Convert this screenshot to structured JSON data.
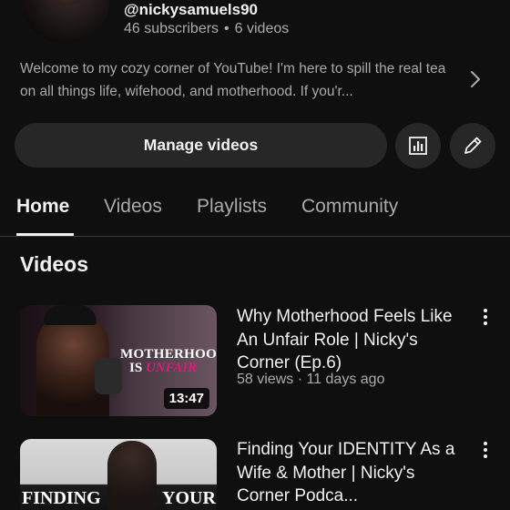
{
  "channel": {
    "handle": "@nickysamuels90",
    "subscribers": "46 subscribers",
    "separator": "•",
    "videos_count": "6 videos",
    "description": "Welcome to my cozy corner of YouTube! I'm here to spill the real tea on all things life, wifehood, and motherhood. If you'r..."
  },
  "actions": {
    "manage_videos": "Manage videos"
  },
  "tabs": [
    {
      "label": "Home",
      "active": true
    },
    {
      "label": "Videos",
      "active": false
    },
    {
      "label": "Playlists",
      "active": false
    },
    {
      "label": "Community",
      "active": false
    }
  ],
  "section": {
    "title": "Videos"
  },
  "videos": [
    {
      "title": "Why Motherhood Feels Like An Unfair Role | Nicky's Corner (Ep.6)",
      "meta": "58 views · 11 days ago",
      "duration": "13:47",
      "thumb_text_line1": "MOTHERHOOD",
      "thumb_text_is": "IS ",
      "thumb_text_unfair": "UNFAIR"
    },
    {
      "title": "Finding Your IDENTITY As a Wife & Mother | Nicky's Corner Podca...",
      "meta": "",
      "thumb_text_left": "FINDING",
      "thumb_text_right": "YOUR"
    }
  ],
  "colors": {
    "background": "#0f0f0f",
    "secondary_text": "#aaaaaa",
    "button_bg": "#272727",
    "accent_pink": "#e0197a"
  },
  "icons": {
    "chevron": "chevron-right-icon",
    "stats": "bar-chart-icon",
    "edit": "pencil-icon",
    "more": "more-vert-icon"
  }
}
